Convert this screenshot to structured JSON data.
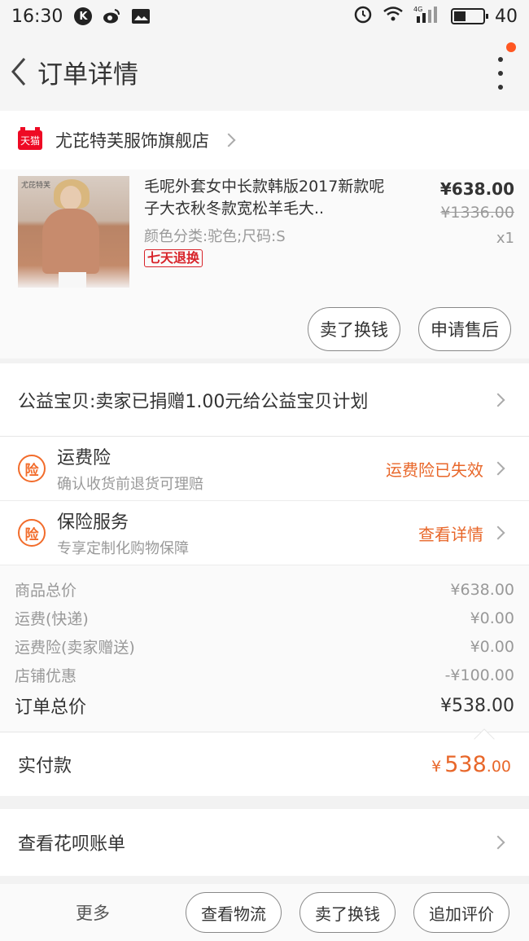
{
  "status_bar": {
    "time": "16:30",
    "battery": "40",
    "network": "4G",
    "battery_level": 0.4
  },
  "header": {
    "title": "订单详情"
  },
  "store": {
    "name": "尤芘特芙服饰旗舰店",
    "badge": "天猫"
  },
  "product": {
    "image_brand_text": "尤芘特芙",
    "title": "毛呢外套女中长款韩版2017新款呢子大衣秋冬款宽松羊毛大..",
    "sku": "颜色分类:驼色;尺码:S",
    "tag": "七天退换",
    "price": "¥638.00",
    "original_price": "¥1336.00",
    "quantity": "x1"
  },
  "product_actions": {
    "sell_exchange": "卖了换钱",
    "after_sale": "申请售后"
  },
  "charity": {
    "text": "公益宝贝:卖家已捐赠1.00元给公益宝贝计划"
  },
  "insurance": [
    {
      "icon_text": "险",
      "title": "运费险",
      "subtitle": "确认收货前退货可理赔",
      "status": "运费险已失效"
    },
    {
      "icon_text": "险",
      "title": "保险服务",
      "subtitle": "专享定制化购物保障",
      "status": "查看详情"
    }
  ],
  "summary": {
    "rows": [
      {
        "label": "商品总价",
        "value": "¥638.00"
      },
      {
        "label": "运费(快递)",
        "value": "¥0.00"
      },
      {
        "label": "运费险(卖家赠送)",
        "value": "¥0.00"
      },
      {
        "label": "店铺优惠",
        "value": "-¥100.00"
      }
    ],
    "total_label": "订单总价",
    "total_value": "¥538.00"
  },
  "paid": {
    "label": "实付款",
    "symbol": "¥",
    "integer": "538",
    "decimal": ".00"
  },
  "huabei": {
    "text": "查看花呗账单"
  },
  "bottom_bar": {
    "more": "更多",
    "buttons": [
      "查看物流",
      "卖了换钱",
      "追加评价"
    ]
  },
  "colors": {
    "accent": "#e8672a",
    "tmall_red": "#ee0a24",
    "notification_dot": "#ff5722"
  }
}
